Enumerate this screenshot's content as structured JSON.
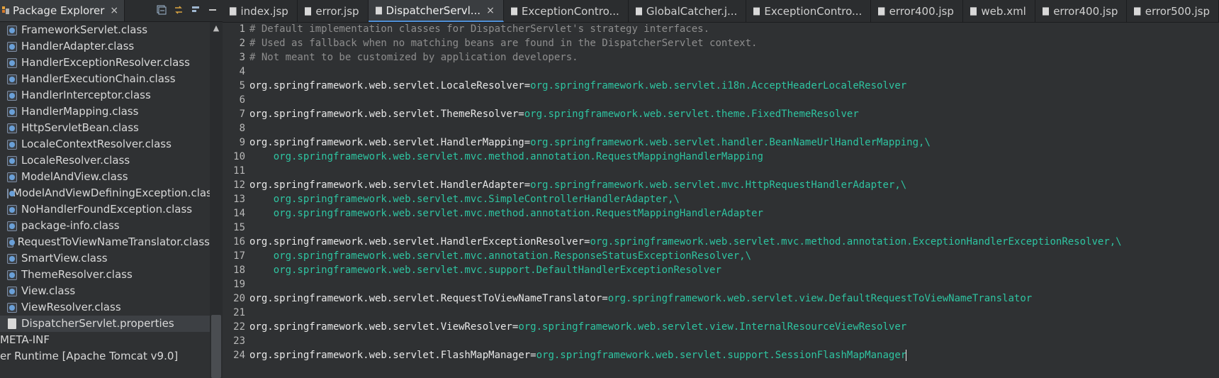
{
  "package_explorer": {
    "title": "Package Explorer",
    "close": "×",
    "items": [
      {
        "label": "FrameworkServlet.class",
        "kind": "class"
      },
      {
        "label": "HandlerAdapter.class",
        "kind": "class"
      },
      {
        "label": "HandlerExceptionResolver.class",
        "kind": "class"
      },
      {
        "label": "HandlerExecutionChain.class",
        "kind": "class"
      },
      {
        "label": "HandlerInterceptor.class",
        "kind": "class"
      },
      {
        "label": "HandlerMapping.class",
        "kind": "class"
      },
      {
        "label": "HttpServletBean.class",
        "kind": "class"
      },
      {
        "label": "LocaleContextResolver.class",
        "kind": "class"
      },
      {
        "label": "LocaleResolver.class",
        "kind": "class"
      },
      {
        "label": "ModelAndView.class",
        "kind": "class"
      },
      {
        "label": "ModelAndViewDefiningException.class",
        "kind": "class"
      },
      {
        "label": "NoHandlerFoundException.class",
        "kind": "class"
      },
      {
        "label": "package-info.class",
        "kind": "class"
      },
      {
        "label": "RequestToViewNameTranslator.class",
        "kind": "class"
      },
      {
        "label": "SmartView.class",
        "kind": "class"
      },
      {
        "label": "ThemeResolver.class",
        "kind": "class"
      },
      {
        "label": "View.class",
        "kind": "class"
      },
      {
        "label": "ViewResolver.class",
        "kind": "class"
      },
      {
        "label": "DispatcherServlet.properties",
        "kind": "file",
        "selected": true
      },
      {
        "label": "META-INF",
        "kind": "plain"
      },
      {
        "label": "er Runtime [Apache Tomcat v9.0]",
        "kind": "plain"
      }
    ]
  },
  "editor_tabs": [
    {
      "label": "index.jsp",
      "active": false
    },
    {
      "label": "error.jsp",
      "active": false
    },
    {
      "label": "DispatcherServl...",
      "active": true,
      "close": "×"
    },
    {
      "label": "ExceptionContro...",
      "active": false
    },
    {
      "label": "GlobalCatcher.j...",
      "active": false
    },
    {
      "label": "ExceptionContro...",
      "active": false
    },
    {
      "label": "error400.jsp",
      "active": false
    },
    {
      "label": "web.xml",
      "active": false
    },
    {
      "label": "error400.jsp",
      "active": false
    },
    {
      "label": "error500.jsp",
      "active": false
    }
  ],
  "code_lines": [
    {
      "n": "1",
      "type": "comment",
      "text": "# Default implementation classes for DispatcherServlet's strategy interfaces."
    },
    {
      "n": "2",
      "type": "comment",
      "text": "# Used as fallback when no matching beans are found in the DispatcherServlet context."
    },
    {
      "n": "3",
      "type": "comment",
      "text": "# Not meant to be customized by application developers."
    },
    {
      "n": "4",
      "type": "blank",
      "text": ""
    },
    {
      "n": "5",
      "type": "prop",
      "key": "org.springframework.web.servlet.LocaleResolver",
      "value": "org.springframework.web.servlet.i18n.AcceptHeaderLocaleResolver"
    },
    {
      "n": "6",
      "type": "blank",
      "text": ""
    },
    {
      "n": "7",
      "type": "prop",
      "key": "org.springframework.web.servlet.ThemeResolver",
      "value": "org.springframework.web.servlet.theme.FixedThemeResolver"
    },
    {
      "n": "8",
      "type": "blank",
      "text": ""
    },
    {
      "n": "9",
      "type": "prop",
      "key": "org.springframework.web.servlet.HandlerMapping",
      "value": "org.springframework.web.servlet.handler.BeanNameUrlHandlerMapping,\\"
    },
    {
      "n": "10",
      "type": "cont",
      "text": "    org.springframework.web.servlet.mvc.method.annotation.RequestMappingHandlerMapping"
    },
    {
      "n": "11",
      "type": "blank",
      "text": ""
    },
    {
      "n": "12",
      "type": "prop",
      "key": "org.springframework.web.servlet.HandlerAdapter",
      "value": "org.springframework.web.servlet.mvc.HttpRequestHandlerAdapter,\\"
    },
    {
      "n": "13",
      "type": "cont",
      "text": "    org.springframework.web.servlet.mvc.SimpleControllerHandlerAdapter,\\"
    },
    {
      "n": "14",
      "type": "cont",
      "text": "    org.springframework.web.servlet.mvc.method.annotation.RequestMappingHandlerAdapter"
    },
    {
      "n": "15",
      "type": "blank",
      "text": ""
    },
    {
      "n": "16",
      "type": "prop",
      "key": "org.springframework.web.servlet.HandlerExceptionResolver",
      "value": "org.springframework.web.servlet.mvc.method.annotation.ExceptionHandlerExceptionResolver,\\"
    },
    {
      "n": "17",
      "type": "cont",
      "text": "    org.springframework.web.servlet.mvc.annotation.ResponseStatusExceptionResolver,\\"
    },
    {
      "n": "18",
      "type": "cont",
      "text": "    org.springframework.web.servlet.mvc.support.DefaultHandlerExceptionResolver"
    },
    {
      "n": "19",
      "type": "blank",
      "text": ""
    },
    {
      "n": "20",
      "type": "prop",
      "key": "org.springframework.web.servlet.RequestToViewNameTranslator",
      "value": "org.springframework.web.servlet.view.DefaultRequestToViewNameTranslator"
    },
    {
      "n": "21",
      "type": "blank",
      "text": ""
    },
    {
      "n": "22",
      "type": "prop",
      "key": "org.springframework.web.servlet.ViewResolver",
      "value": "org.springframework.web.servlet.view.InternalResourceViewResolver"
    },
    {
      "n": "23",
      "type": "blank",
      "text": ""
    },
    {
      "n": "24",
      "type": "prop",
      "key": "org.springframework.web.servlet.FlashMapManager",
      "value": "org.springframework.web.servlet.support.SessionFlashMapManager",
      "caret": true
    }
  ],
  "colors": {
    "background": "#2f3133",
    "value": "#2ec4a1",
    "comment": "#8e8e8e",
    "key": "#e7e7e7",
    "active_tab": "#3a3d40"
  }
}
